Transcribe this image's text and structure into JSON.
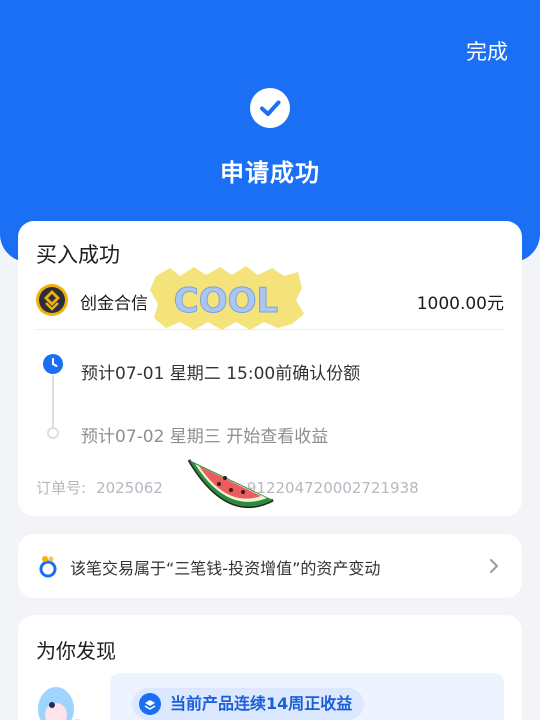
{
  "header": {
    "done_label": "完成",
    "title": "申请成功",
    "bg_color": "#1b6ff5"
  },
  "order_card": {
    "title": "买入成功",
    "product_icon": "gold-coin-icon",
    "product_name": "创金合信",
    "amount": "1000.00元",
    "steps": [
      {
        "icon": "clock-icon",
        "text": "预计07-01 星期二 15:00前确认份额"
      },
      {
        "icon": "pending-dot",
        "text": "预计07-02 星期三 开始查看收益"
      }
    ],
    "order_label": "订单号:",
    "order_number_head": "2025062",
    "order_number_tail": "912204720002721938"
  },
  "asset_link": {
    "icon": "three-coins-icon",
    "text": "该笔交易属于“三笔钱-投资增值”的资产变动",
    "chevron": "chevron-right-icon"
  },
  "discover": {
    "title": "为你发现",
    "badge_icon": "shield-layers-icon",
    "badge_text": "当前产品连续14周正收益"
  },
  "stickers": {
    "cool_text": "COOL",
    "melon": "watermelon-sticker"
  }
}
